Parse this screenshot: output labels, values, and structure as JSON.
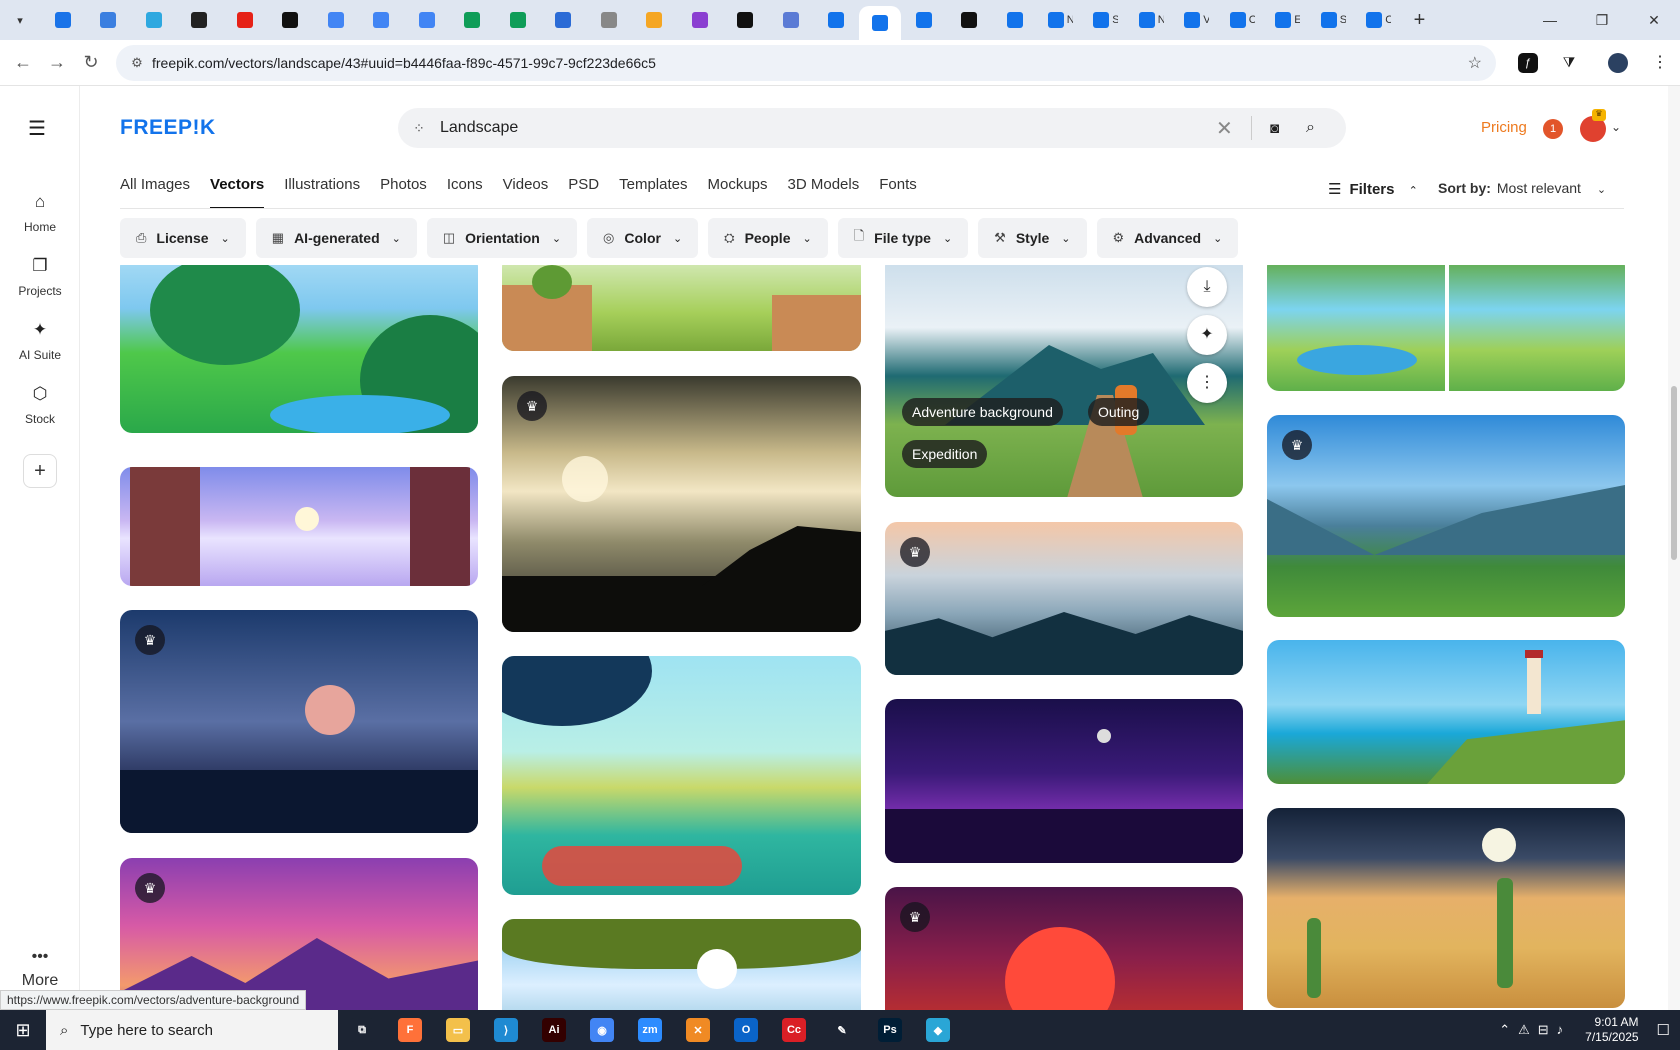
{
  "browser": {
    "tabs": [
      {
        "color": "#1a73e8",
        "label": ""
      },
      {
        "color": "#3b7fe0",
        "label": ""
      },
      {
        "color": "#2ea8e0",
        "label": ""
      },
      {
        "color": "#222222",
        "label": ""
      },
      {
        "color": "#e62117",
        "label": ""
      },
      {
        "color": "#111111",
        "label": ""
      },
      {
        "color": "#4285f4",
        "label": ""
      },
      {
        "color": "#4285f4",
        "label": ""
      },
      {
        "color": "#4285f4",
        "label": ""
      },
      {
        "color": "#0f9d58",
        "label": ""
      },
      {
        "color": "#0f9d58",
        "label": ""
      },
      {
        "color": "#2b6bd6",
        "label": ""
      },
      {
        "color": "#888888",
        "label": ""
      },
      {
        "color": "#f5a623",
        "label": ""
      },
      {
        "color": "#8a3fd1",
        "label": ""
      },
      {
        "color": "#111111",
        "label": ""
      },
      {
        "color": "#5b7bd5",
        "label": ""
      },
      {
        "color": "#1273eb",
        "label": ""
      },
      {
        "color": "#1273eb",
        "label": ""
      },
      {
        "color": "#1273eb",
        "label": ""
      },
      {
        "color": "#111111",
        "label": ""
      },
      {
        "color": "#1273eb",
        "label": ""
      },
      {
        "color": "#1273eb",
        "label": "N"
      },
      {
        "color": "#1273eb",
        "label": "S"
      },
      {
        "color": "#1273eb",
        "label": "N"
      },
      {
        "color": "#1273eb",
        "label": "V"
      },
      {
        "color": "#1273eb",
        "label": "C"
      },
      {
        "color": "#1273eb",
        "label": "E"
      },
      {
        "color": "#1273eb",
        "label": "S"
      },
      {
        "color": "#1273eb",
        "label": "C"
      }
    ],
    "active_tab_index": 18,
    "new_tab_label": "+",
    "url": "freepik.com/vectors/landscape/43#uuid=b4446faa-f89c-4571-99c7-9cf223de66c5",
    "status_url": "https://www.freepik.com/vectors/adventure-background"
  },
  "rail": {
    "items": [
      {
        "label": "Home",
        "icon": "⌂"
      },
      {
        "label": "Projects",
        "icon": "❐"
      },
      {
        "label": "AI Suite",
        "icon": "✦"
      },
      {
        "label": "Stock",
        "icon": "⬡"
      }
    ],
    "more_label": "More"
  },
  "header": {
    "logo": "FREEP!K",
    "search_value": "Landscape",
    "pricing_label": "Pricing",
    "notification_count": "1"
  },
  "categories": [
    "All Images",
    "Vectors",
    "Illustrations",
    "Photos",
    "Icons",
    "Videos",
    "PSD",
    "Templates",
    "Mockups",
    "3D Models",
    "Fonts"
  ],
  "active_category": "Vectors",
  "filters_label": "Filters",
  "sort": {
    "label": "Sort by:",
    "value": "Most relevant"
  },
  "chips": [
    {
      "label": "License",
      "icon": "⎙"
    },
    {
      "label": "AI-generated",
      "icon": "▦"
    },
    {
      "label": "Orientation",
      "icon": "◫"
    },
    {
      "label": "Color",
      "icon": "◎"
    },
    {
      "label": "People",
      "icon": "⛭"
    },
    {
      "label": "File type",
      "icon": "🗋"
    },
    {
      "label": "Style",
      "icon": "⚒"
    },
    {
      "label": "Advanced",
      "icon": "⚙"
    }
  ],
  "hovered_card": {
    "tags": [
      "Adventure background",
      "Outing",
      "Expedition"
    ]
  },
  "taskbar": {
    "search_placeholder": "Type here to search",
    "apps": [
      {
        "name": "task-view",
        "color": "#1c2433",
        "glyph": "⧉"
      },
      {
        "name": "firefox",
        "color": "#ff7139",
        "glyph": "F"
      },
      {
        "name": "file-explorer",
        "color": "#f3c04b",
        "glyph": "▭"
      },
      {
        "name": "vscode",
        "color": "#1f8ad2",
        "glyph": "⟩"
      },
      {
        "name": "illustrator",
        "color": "#330000",
        "glyph": "Ai"
      },
      {
        "name": "chrome",
        "color": "#4285f4",
        "glyph": "◉"
      },
      {
        "name": "zoom",
        "color": "#2d8cff",
        "glyph": "zm"
      },
      {
        "name": "app-orange",
        "color": "#f08a24",
        "glyph": "✕"
      },
      {
        "name": "outlook",
        "color": "#0a64c9",
        "glyph": "O"
      },
      {
        "name": "creative-cloud",
        "color": "#da1f26",
        "glyph": "Cc"
      },
      {
        "name": "pen-tool",
        "color": "#1c2433",
        "glyph": "✎"
      },
      {
        "name": "photoshop",
        "color": "#001e36",
        "glyph": "Ps"
      },
      {
        "name": "app-blue",
        "color": "#2aa6d6",
        "glyph": "◆"
      }
    ],
    "time": "9:01 AM",
    "date": "7/15/2025"
  }
}
